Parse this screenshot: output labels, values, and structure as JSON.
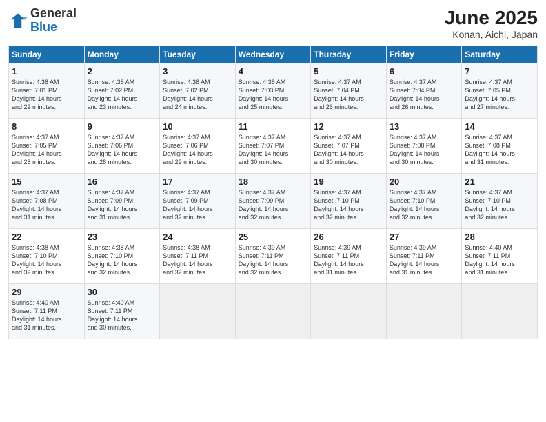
{
  "header": {
    "logo_general": "General",
    "logo_blue": "Blue",
    "month_title": "June 2025",
    "location": "Konan, Aichi, Japan"
  },
  "weekdays": [
    "Sunday",
    "Monday",
    "Tuesday",
    "Wednesday",
    "Thursday",
    "Friday",
    "Saturday"
  ],
  "weeks": [
    [
      {
        "day": "1",
        "lines": [
          "Sunrise: 4:38 AM",
          "Sunset: 7:01 PM",
          "Daylight: 14 hours",
          "and 22 minutes."
        ]
      },
      {
        "day": "2",
        "lines": [
          "Sunrise: 4:38 AM",
          "Sunset: 7:02 PM",
          "Daylight: 14 hours",
          "and 23 minutes."
        ]
      },
      {
        "day": "3",
        "lines": [
          "Sunrise: 4:38 AM",
          "Sunset: 7:02 PM",
          "Daylight: 14 hours",
          "and 24 minutes."
        ]
      },
      {
        "day": "4",
        "lines": [
          "Sunrise: 4:38 AM",
          "Sunset: 7:03 PM",
          "Daylight: 14 hours",
          "and 25 minutes."
        ]
      },
      {
        "day": "5",
        "lines": [
          "Sunrise: 4:37 AM",
          "Sunset: 7:04 PM",
          "Daylight: 14 hours",
          "and 26 minutes."
        ]
      },
      {
        "day": "6",
        "lines": [
          "Sunrise: 4:37 AM",
          "Sunset: 7:04 PM",
          "Daylight: 14 hours",
          "and 26 minutes."
        ]
      },
      {
        "day": "7",
        "lines": [
          "Sunrise: 4:37 AM",
          "Sunset: 7:05 PM",
          "Daylight: 14 hours",
          "and 27 minutes."
        ]
      }
    ],
    [
      {
        "day": "8",
        "lines": [
          "Sunrise: 4:37 AM",
          "Sunset: 7:05 PM",
          "Daylight: 14 hours",
          "and 28 minutes."
        ]
      },
      {
        "day": "9",
        "lines": [
          "Sunrise: 4:37 AM",
          "Sunset: 7:06 PM",
          "Daylight: 14 hours",
          "and 28 minutes."
        ]
      },
      {
        "day": "10",
        "lines": [
          "Sunrise: 4:37 AM",
          "Sunset: 7:06 PM",
          "Daylight: 14 hours",
          "and 29 minutes."
        ]
      },
      {
        "day": "11",
        "lines": [
          "Sunrise: 4:37 AM",
          "Sunset: 7:07 PM",
          "Daylight: 14 hours",
          "and 30 minutes."
        ]
      },
      {
        "day": "12",
        "lines": [
          "Sunrise: 4:37 AM",
          "Sunset: 7:07 PM",
          "Daylight: 14 hours",
          "and 30 minutes."
        ]
      },
      {
        "day": "13",
        "lines": [
          "Sunrise: 4:37 AM",
          "Sunset: 7:08 PM",
          "Daylight: 14 hours",
          "and 30 minutes."
        ]
      },
      {
        "day": "14",
        "lines": [
          "Sunrise: 4:37 AM",
          "Sunset: 7:08 PM",
          "Daylight: 14 hours",
          "and 31 minutes."
        ]
      }
    ],
    [
      {
        "day": "15",
        "lines": [
          "Sunrise: 4:37 AM",
          "Sunset: 7:08 PM",
          "Daylight: 14 hours",
          "and 31 minutes."
        ]
      },
      {
        "day": "16",
        "lines": [
          "Sunrise: 4:37 AM",
          "Sunset: 7:09 PM",
          "Daylight: 14 hours",
          "and 31 minutes."
        ]
      },
      {
        "day": "17",
        "lines": [
          "Sunrise: 4:37 AM",
          "Sunset: 7:09 PM",
          "Daylight: 14 hours",
          "and 32 minutes."
        ]
      },
      {
        "day": "18",
        "lines": [
          "Sunrise: 4:37 AM",
          "Sunset: 7:09 PM",
          "Daylight: 14 hours",
          "and 32 minutes."
        ]
      },
      {
        "day": "19",
        "lines": [
          "Sunrise: 4:37 AM",
          "Sunset: 7:10 PM",
          "Daylight: 14 hours",
          "and 32 minutes."
        ]
      },
      {
        "day": "20",
        "lines": [
          "Sunrise: 4:37 AM",
          "Sunset: 7:10 PM",
          "Daylight: 14 hours",
          "and 32 minutes."
        ]
      },
      {
        "day": "21",
        "lines": [
          "Sunrise: 4:37 AM",
          "Sunset: 7:10 PM",
          "Daylight: 14 hours",
          "and 32 minutes."
        ]
      }
    ],
    [
      {
        "day": "22",
        "lines": [
          "Sunrise: 4:38 AM",
          "Sunset: 7:10 PM",
          "Daylight: 14 hours",
          "and 32 minutes."
        ]
      },
      {
        "day": "23",
        "lines": [
          "Sunrise: 4:38 AM",
          "Sunset: 7:10 PM",
          "Daylight: 14 hours",
          "and 32 minutes."
        ]
      },
      {
        "day": "24",
        "lines": [
          "Sunrise: 4:38 AM",
          "Sunset: 7:11 PM",
          "Daylight: 14 hours",
          "and 32 minutes."
        ]
      },
      {
        "day": "25",
        "lines": [
          "Sunrise: 4:39 AM",
          "Sunset: 7:11 PM",
          "Daylight: 14 hours",
          "and 32 minutes."
        ]
      },
      {
        "day": "26",
        "lines": [
          "Sunrise: 4:39 AM",
          "Sunset: 7:11 PM",
          "Daylight: 14 hours",
          "and 31 minutes."
        ]
      },
      {
        "day": "27",
        "lines": [
          "Sunrise: 4:39 AM",
          "Sunset: 7:11 PM",
          "Daylight: 14 hours",
          "and 31 minutes."
        ]
      },
      {
        "day": "28",
        "lines": [
          "Sunrise: 4:40 AM",
          "Sunset: 7:11 PM",
          "Daylight: 14 hours",
          "and 31 minutes."
        ]
      }
    ],
    [
      {
        "day": "29",
        "lines": [
          "Sunrise: 4:40 AM",
          "Sunset: 7:11 PM",
          "Daylight: 14 hours",
          "and 31 minutes."
        ]
      },
      {
        "day": "30",
        "lines": [
          "Sunrise: 4:40 AM",
          "Sunset: 7:11 PM",
          "Daylight: 14 hours",
          "and 30 minutes."
        ]
      },
      {
        "day": "",
        "lines": []
      },
      {
        "day": "",
        "lines": []
      },
      {
        "day": "",
        "lines": []
      },
      {
        "day": "",
        "lines": []
      },
      {
        "day": "",
        "lines": []
      }
    ]
  ]
}
